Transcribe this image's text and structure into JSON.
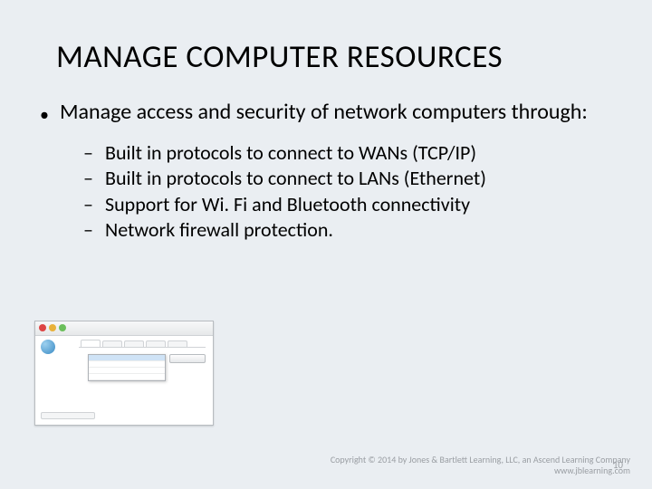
{
  "title": "MANAGE COMPUTER RESOURCES",
  "main_bullet": "Manage access and security of network computers through:",
  "sub_bullets": [
    "Built in protocols to connect to WANs (TCP/IP)",
    "Built in protocols to connect to LANs (Ethernet)",
    "Support for Wi. Fi and Bluetooth connectivity",
    "Network firewall protection."
  ],
  "footer_line1": "Copyright © 2014 by Jones & Bartlett Learning, LLC, an Ascend Learning Company",
  "footer_line2": "www.jblearning.com",
  "page_number": "10"
}
